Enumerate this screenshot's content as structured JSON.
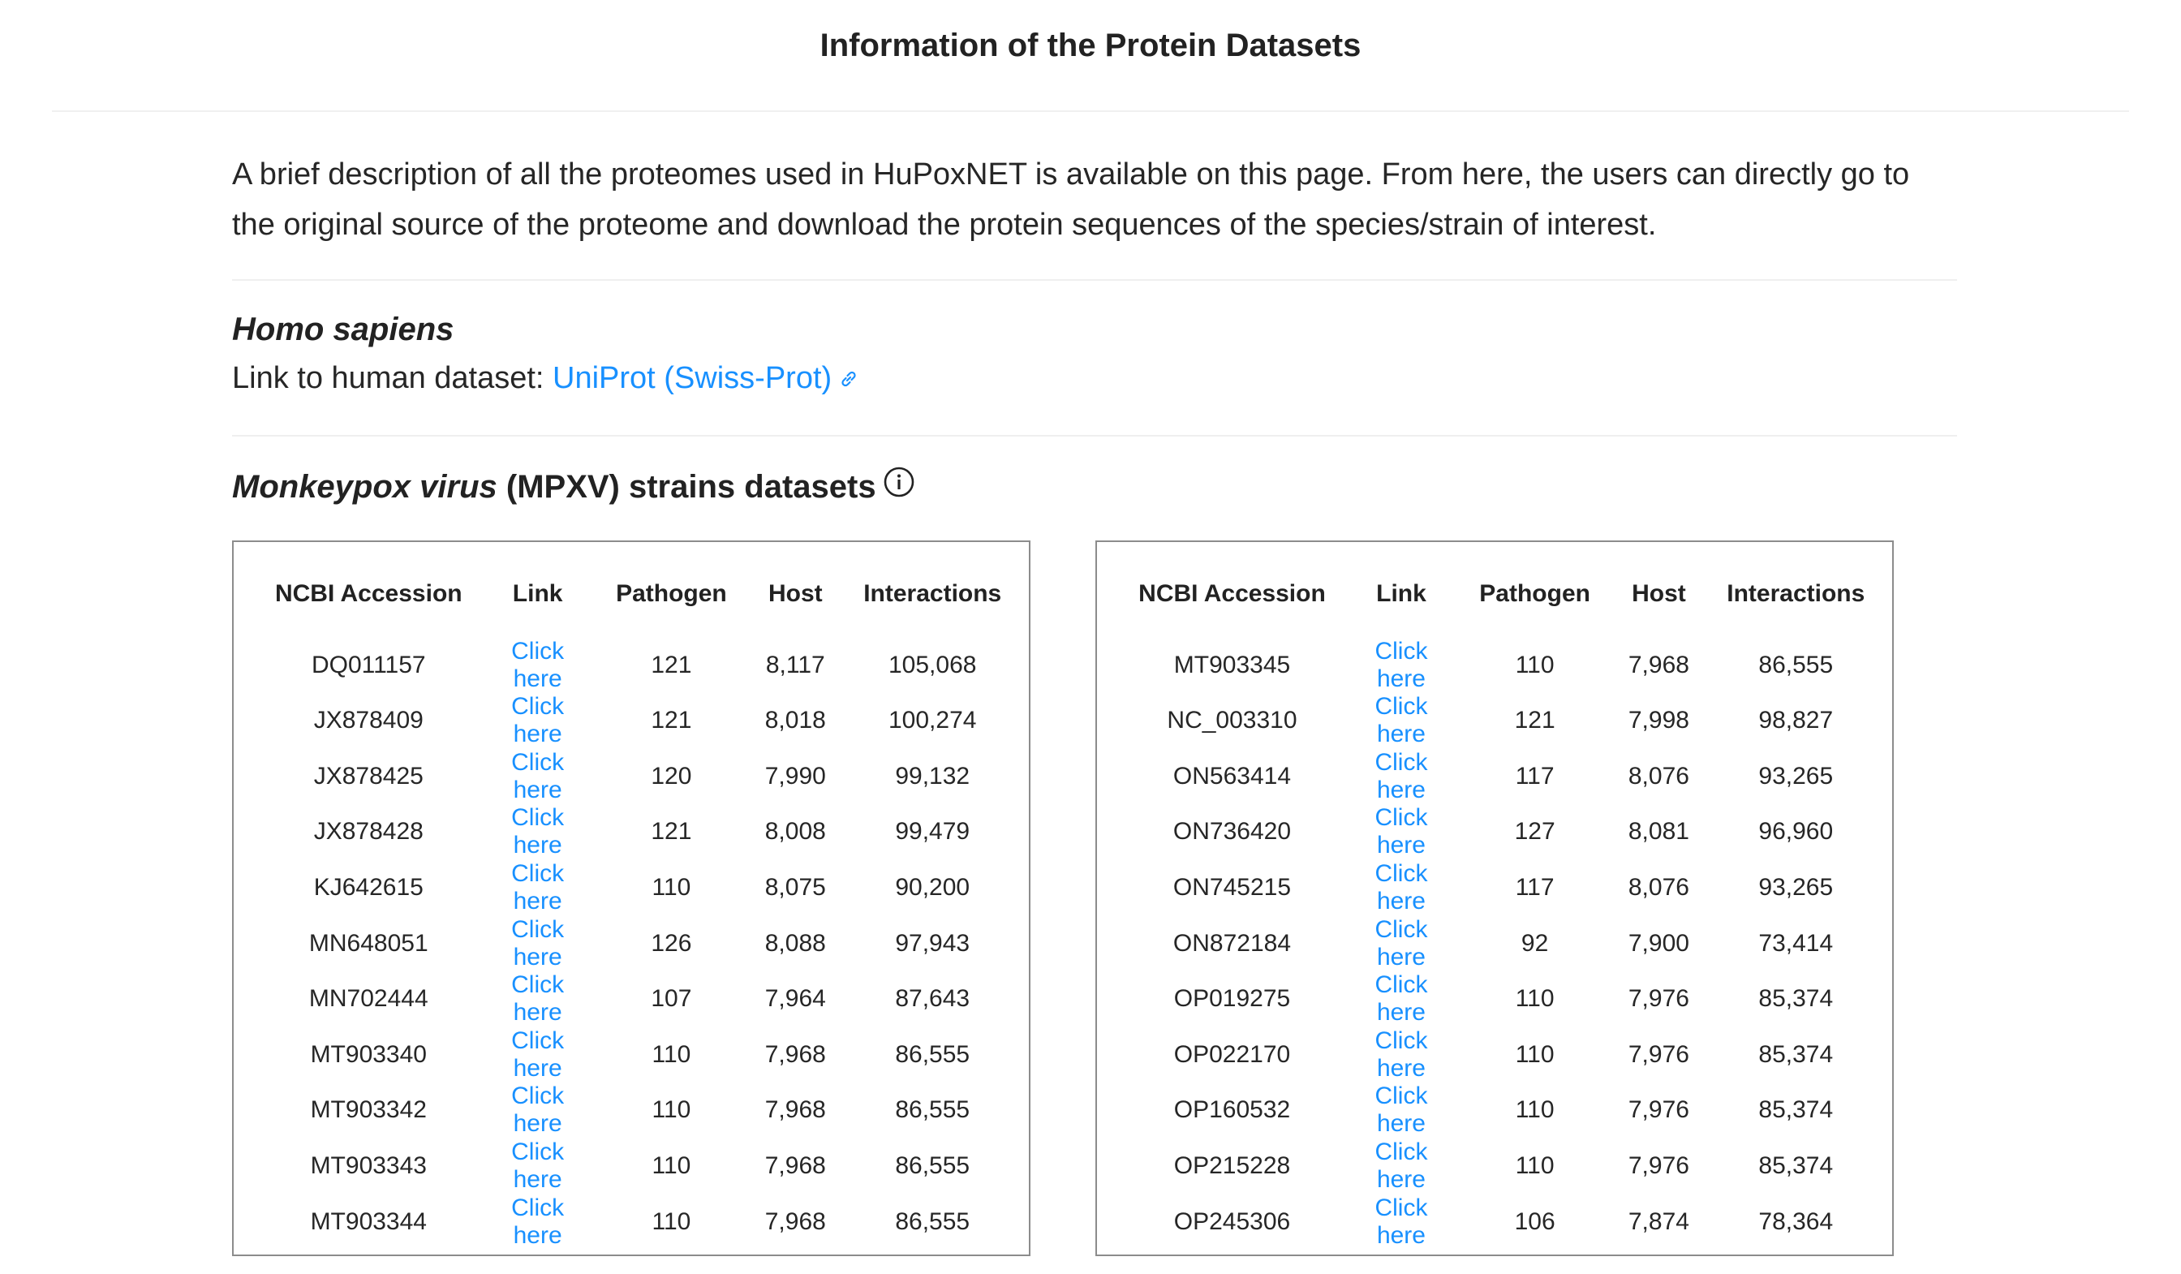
{
  "page": {
    "title": "Information of the Protein Datasets",
    "description": "A brief description of all the proteomes used in HuPoxNET is available on this page. From here, the users can directly go to the original source of the proteome and download the protein sequences of the species/strain of interest."
  },
  "human": {
    "species": "Homo sapiens",
    "link_prefix": "Link to human dataset: ",
    "link_text": "UniProt (Swiss-Prot)",
    "link_icon": "external-link-icon"
  },
  "mpxv": {
    "species_italic": "Monkeypox virus",
    "title_rest": " (MPXV) strains datasets",
    "info_icon": "info-circle-icon"
  },
  "table_headers": [
    "NCBI Accession",
    "Link",
    "Pathogen",
    "Host",
    "Interactions"
  ],
  "link_label": "Click here",
  "colors": {
    "link": "#1890ff",
    "text": "#222222",
    "border": "#8c8c8c"
  },
  "left_table": {
    "rows": [
      [
        "DQ011157",
        "Click here",
        "121",
        "8,117",
        "105,068"
      ],
      [
        "JX878409",
        "Click here",
        "121",
        "8,018",
        "100,274"
      ],
      [
        "JX878425",
        "Click here",
        "120",
        "7,990",
        "99,132"
      ],
      [
        "JX878428",
        "Click here",
        "121",
        "8,008",
        "99,479"
      ],
      [
        "KJ642615",
        "Click here",
        "110",
        "8,075",
        "90,200"
      ],
      [
        "MN648051",
        "Click here",
        "126",
        "8,088",
        "97,943"
      ],
      [
        "MN702444",
        "Click here",
        "107",
        "7,964",
        "87,643"
      ],
      [
        "MT903340",
        "Click here",
        "110",
        "7,968",
        "86,555"
      ],
      [
        "MT903342",
        "Click here",
        "110",
        "7,968",
        "86,555"
      ],
      [
        "MT903343",
        "Click here",
        "110",
        "7,968",
        "86,555"
      ],
      [
        "MT903344",
        "Click here",
        "110",
        "7,968",
        "86,555"
      ]
    ]
  },
  "right_table": {
    "rows": [
      [
        "MT903345",
        "Click here",
        "110",
        "7,968",
        "86,555"
      ],
      [
        "NC_003310",
        "Click here",
        "121",
        "7,998",
        "98,827"
      ],
      [
        "ON563414",
        "Click here",
        "117",
        "8,076",
        "93,265"
      ],
      [
        "ON736420",
        "Click here",
        "127",
        "8,081",
        "96,960"
      ],
      [
        "ON745215",
        "Click here",
        "117",
        "8,076",
        "93,265"
      ],
      [
        "ON872184",
        "Click here",
        "92",
        "7,900",
        "73,414"
      ],
      [
        "OP019275",
        "Click here",
        "110",
        "7,976",
        "85,374"
      ],
      [
        "OP022170",
        "Click here",
        "110",
        "7,976",
        "85,374"
      ],
      [
        "OP160532",
        "Click here",
        "110",
        "7,976",
        "85,374"
      ],
      [
        "OP215228",
        "Click here",
        "110",
        "7,976",
        "85,374"
      ],
      [
        "OP245306",
        "Click here",
        "106",
        "7,874",
        "78,364"
      ]
    ]
  }
}
